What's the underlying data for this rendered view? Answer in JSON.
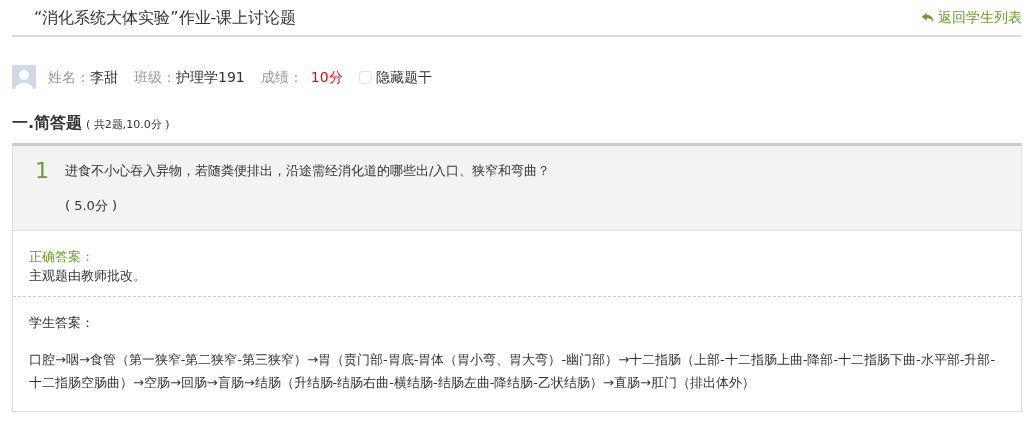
{
  "header": {
    "title": "“消化系统大体实验”作业-课上讨论题",
    "back_link": "返回学生列表"
  },
  "student": {
    "name_label": "姓名：",
    "name": "李甜",
    "class_label": "班级：",
    "class": "护理学191",
    "score_label": "成绩：",
    "score": "10分",
    "hide_stem": {
      "label": "隐藏题干",
      "checked": false
    }
  },
  "section": {
    "title": "一.简答题",
    "summary": "( 共2题,10.0分 )"
  },
  "questions": [
    {
      "number": "1",
      "text": "进食不小心吞入异物，若随粪便排出，沿途需经消化道的哪些出/入口、狭窄和弯曲？",
      "points": "( 5.0分 )",
      "correct_label": "正确答案：",
      "correct_answer": "主观题由教师批改。",
      "student_label": "学生答案：",
      "student_answer": "口腔→咽→食管（第一狭窄-第二狭窄-第三狭窄）→胃（贲门部-胃底-胃体（胃小弯、胃大弯）-幽门部）→十二指肠（上部-十二指肠上曲-降部-十二指肠下曲-水平部-升部-十二指肠空肠曲）→空肠→回肠→盲肠→结肠（升结肠-结肠右曲-横结肠-结肠左曲-降结肠-乙状结肠）→直肠→肛门（排出体外）"
    }
  ]
}
